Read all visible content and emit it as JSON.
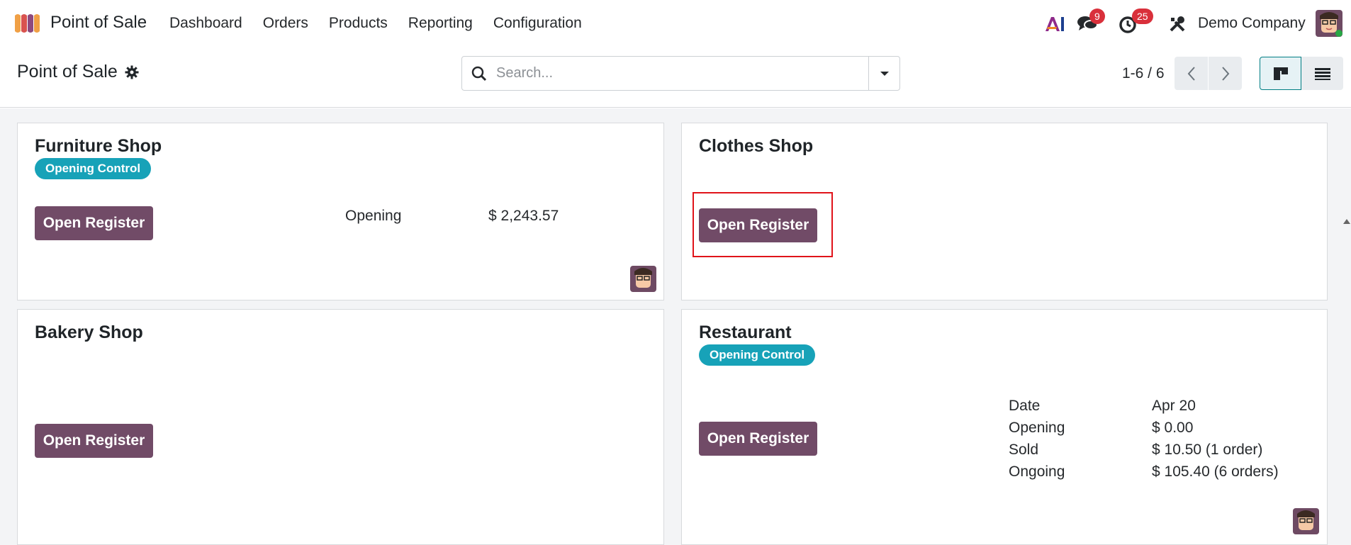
{
  "navbar": {
    "app_name": "Point of Sale",
    "menu": [
      "Dashboard",
      "Orders",
      "Products",
      "Reporting",
      "Configuration"
    ],
    "messages_count": "9",
    "activities_count": "25",
    "company": "Demo Company"
  },
  "control_panel": {
    "breadcrumb": "Point of Sale",
    "search_placeholder": "Search...",
    "pager": "1-6 / 6"
  },
  "cards": [
    {
      "title": "Furniture Shop",
      "status": "Opening Control",
      "button": "Open Register",
      "stats": [
        {
          "label": "Opening",
          "value": "$ 2,243.57"
        }
      ]
    },
    {
      "title": "Clothes Shop",
      "button": "Open Register"
    },
    {
      "title": "Bakery Shop",
      "button": "Open Register"
    },
    {
      "title": "Restaurant",
      "status": "Opening Control",
      "button": "Open Register",
      "stats": [
        {
          "label": "Date",
          "value": "Apr 20"
        },
        {
          "label": "Opening",
          "value": "$ 0.00"
        },
        {
          "label": "Sold",
          "value": "$ 10.50 (1 order)"
        },
        {
          "label": "Ongoing",
          "value": "$ 105.40 (6 orders)"
        }
      ]
    }
  ],
  "colors": {
    "primary": "#714b67",
    "badge": "#17a2b8",
    "notification": "#d9303b",
    "highlight": "#e0131a"
  }
}
